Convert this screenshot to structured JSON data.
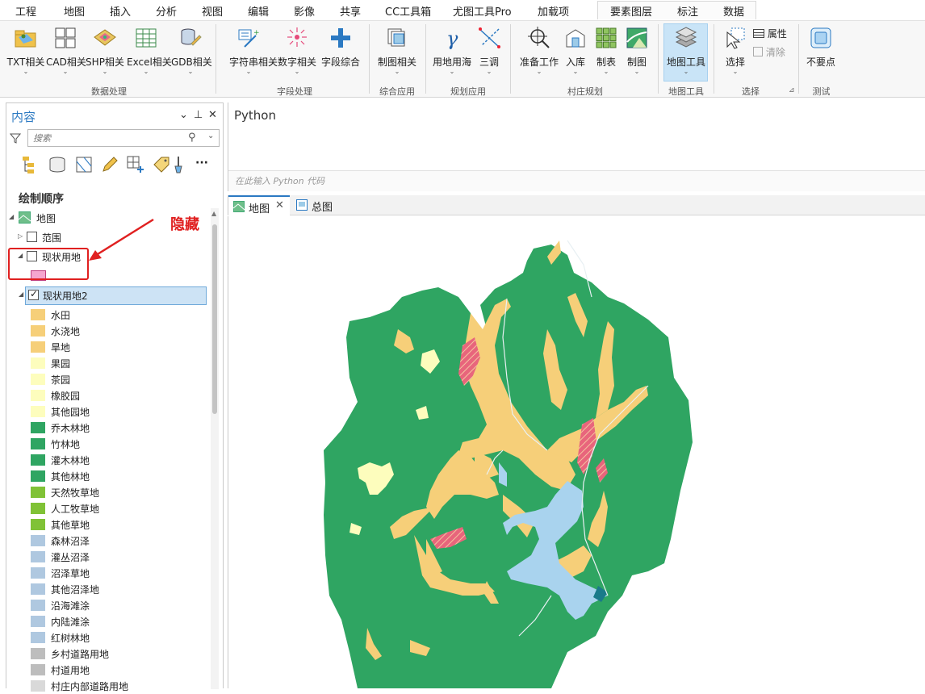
{
  "menu": {
    "tabs": [
      "工程",
      "地图",
      "插入",
      "分析",
      "视图",
      "编辑",
      "影像",
      "共享",
      "CC工具箱",
      "尤图工具Pro",
      "加载项"
    ],
    "active_tab": "CC工具箱",
    "context_tabs": [
      "要素图层",
      "标注",
      "数据"
    ]
  },
  "ribbon": {
    "buttons": [
      "TXT相关",
      "CAD相关",
      "SHP相关",
      "Excel相关",
      "GDB相关",
      "字符串相关",
      "数字相关",
      "字段综合",
      "制图相关",
      "用地用海",
      "三调",
      "准备工作",
      "入库",
      "制表",
      "制图",
      "地图工具",
      "选择",
      "不要点"
    ],
    "small_buttons": {
      "attributes": "属性",
      "clear": "清除"
    },
    "groups": [
      "数据处理",
      "字段处理",
      "综合应用",
      "规划应用",
      "村庄规划",
      "地图工具",
      "选择",
      "测试"
    ],
    "accent_color": "#2b79c2",
    "selected_color": "#c9e4f7"
  },
  "contents": {
    "title": "内容",
    "search_placeholder": "搜索",
    "draw_order_label": "绘制顺序",
    "tree": {
      "map": "地图",
      "extent": "范围",
      "current_land": "现状用地",
      "current_land2": "现状用地2"
    },
    "legend": [
      {
        "label": "水田",
        "color": "#f6cf79"
      },
      {
        "label": "水浇地",
        "color": "#f6cf79"
      },
      {
        "label": "旱地",
        "color": "#f6cf79"
      },
      {
        "label": "果园",
        "color": "#fdfdbd"
      },
      {
        "label": "茶园",
        "color": "#fdfdbd"
      },
      {
        "label": "橡胶园",
        "color": "#fdfdbd"
      },
      {
        "label": "其他园地",
        "color": "#fdfdbd"
      },
      {
        "label": "乔木林地",
        "color": "#2fa562"
      },
      {
        "label": "竹林地",
        "color": "#2fa562"
      },
      {
        "label": "灌木林地",
        "color": "#2fa562"
      },
      {
        "label": "其他林地",
        "color": "#2fa562"
      },
      {
        "label": "天然牧草地",
        "color": "#80c236"
      },
      {
        "label": "人工牧草地",
        "color": "#80c236"
      },
      {
        "label": "其他草地",
        "color": "#80c236"
      },
      {
        "label": "森林沼泽",
        "color": "#afc8e0"
      },
      {
        "label": "灌丛沼泽",
        "color": "#afc8e0"
      },
      {
        "label": "沼泽草地",
        "color": "#afc8e0"
      },
      {
        "label": "其他沼泽地",
        "color": "#afc8e0"
      },
      {
        "label": "沿海滩涂",
        "color": "#afc8e0"
      },
      {
        "label": "内陆滩涂",
        "color": "#afc8e0"
      },
      {
        "label": "红树林地",
        "color": "#afc8e0"
      },
      {
        "label": "乡村道路用地",
        "color": "#bdbdbd"
      },
      {
        "label": "村道用地",
        "color": "#bdbdbd"
      },
      {
        "label": "村庄内部道路用地",
        "color": "#d9d9d9"
      }
    ],
    "hidden_layer_swatch": "#f5a6cf"
  },
  "annotation": {
    "text": "隐藏",
    "color": "#e02020"
  },
  "python": {
    "title": "Python",
    "input_placeholder": "在此输入 Python 代码"
  },
  "map_tabs": [
    "地图",
    "总图"
  ],
  "map_colors": {
    "forest": "#2fa562",
    "farmland": "#f6cf79",
    "orchard": "#fdfdbd",
    "water": "#a9d3ee",
    "construction": "#e8657c"
  }
}
